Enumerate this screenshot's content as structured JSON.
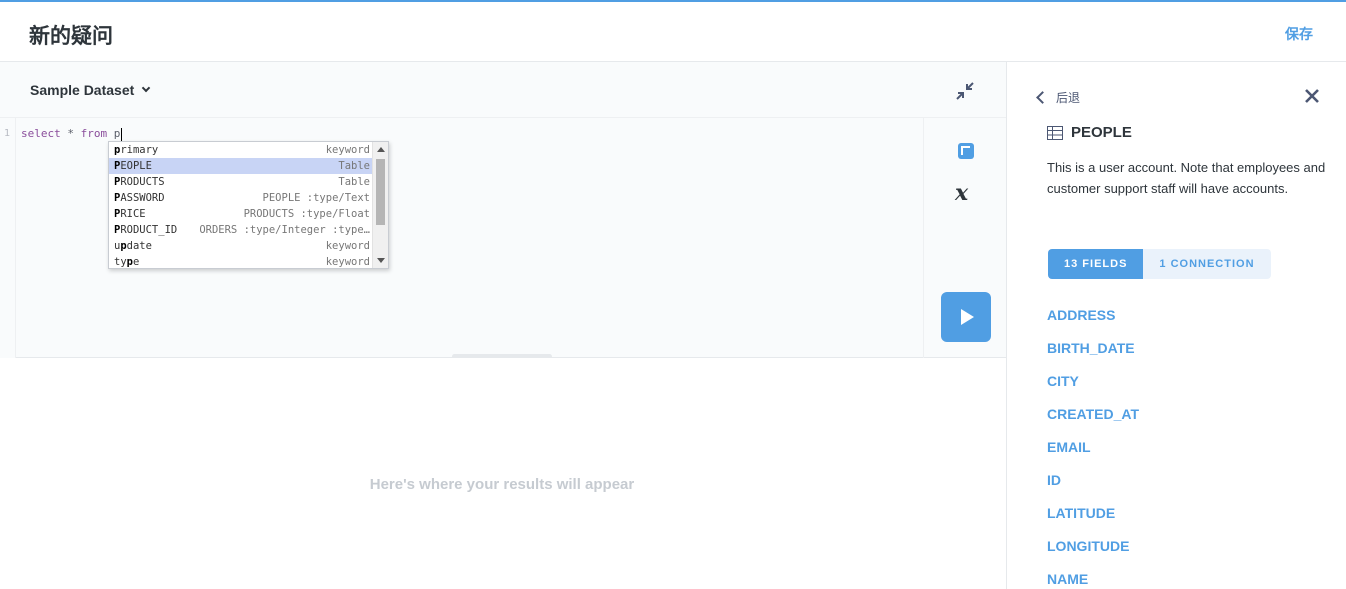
{
  "header": {
    "title": "新的疑问",
    "save_label": "保存"
  },
  "editor": {
    "database_label": "Sample Dataset",
    "line_number": "1",
    "query_keyword_1": "select",
    "query_mid": " * ",
    "query_keyword_2": "from",
    "query_tail": " p"
  },
  "autocomplete": {
    "items": [
      {
        "prefix": "p",
        "rest": "rimary",
        "meta": "keyword",
        "selected": false
      },
      {
        "prefix": "P",
        "rest": "EOPLE",
        "meta": "Table",
        "selected": true
      },
      {
        "prefix": "P",
        "rest": "RODUCTS",
        "meta": "Table",
        "selected": false
      },
      {
        "prefix": "P",
        "rest": "ASSWORD",
        "meta": "PEOPLE :type/Text",
        "selected": false
      },
      {
        "prefix": "P",
        "rest": "RICE",
        "meta": "PRODUCTS :type/Float",
        "selected": false
      },
      {
        "prefix": "P",
        "rest": "RODUCT_ID",
        "meta": "ORDERS :type/Integer :type…",
        "selected": false
      },
      {
        "prefix": "u",
        "rest": "pdate",
        "meta": "keyword",
        "selected": false,
        "split": true,
        "pre": "u",
        "mid": "p",
        "post": "date"
      },
      {
        "prefix": "ty",
        "rest": "pe",
        "meta": "keyword",
        "selected": false,
        "split": true,
        "pre": "ty",
        "mid": "p",
        "post": "e"
      }
    ]
  },
  "results": {
    "empty_message": "Here's where your results will appear"
  },
  "sidebar": {
    "back_label": "后退",
    "table_name": "PEOPLE",
    "description": "This is a user account. Note that employees and customer support staff will have accounts.",
    "tabs": [
      {
        "label": "13 FIELDS",
        "active": true
      },
      {
        "label": "1 CONNECTION",
        "active": false
      }
    ],
    "fields": [
      "ADDRESS",
      "BIRTH_DATE",
      "CITY",
      "CREATED_AT",
      "EMAIL",
      "ID",
      "LATITUDE",
      "LONGITUDE",
      "NAME"
    ]
  },
  "colors": {
    "brand": "#509ee3",
    "text_dark": "#2e353b",
    "placeholder": "#c6cbd1"
  }
}
